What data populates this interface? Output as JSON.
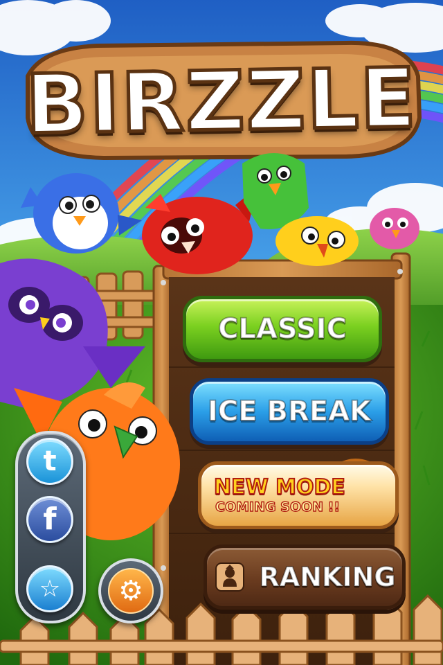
{
  "game": {
    "title": "BIRZZLE"
  },
  "menu": {
    "classic_label": "CLASSIC",
    "icebreak_label": "ICE BREAK",
    "newmode_title": "NEW MODE",
    "newmode_subtitle": "COMING SOON !!",
    "ranking_label": "RANKING"
  },
  "icons": {
    "twitter": "twitter-icon",
    "facebook": "facebook-icon",
    "favorite": "star-icon",
    "settings": "gear-icon",
    "ranking": "person-icon"
  },
  "colors": {
    "classic": "#7bd020",
    "icebreak": "#2b9fe8",
    "newmode": "#ffe3a8",
    "ranking": "#6a3b1f",
    "wood": "#c98a45",
    "sky": "#3f8de0",
    "grass": "#3c9a1c"
  }
}
